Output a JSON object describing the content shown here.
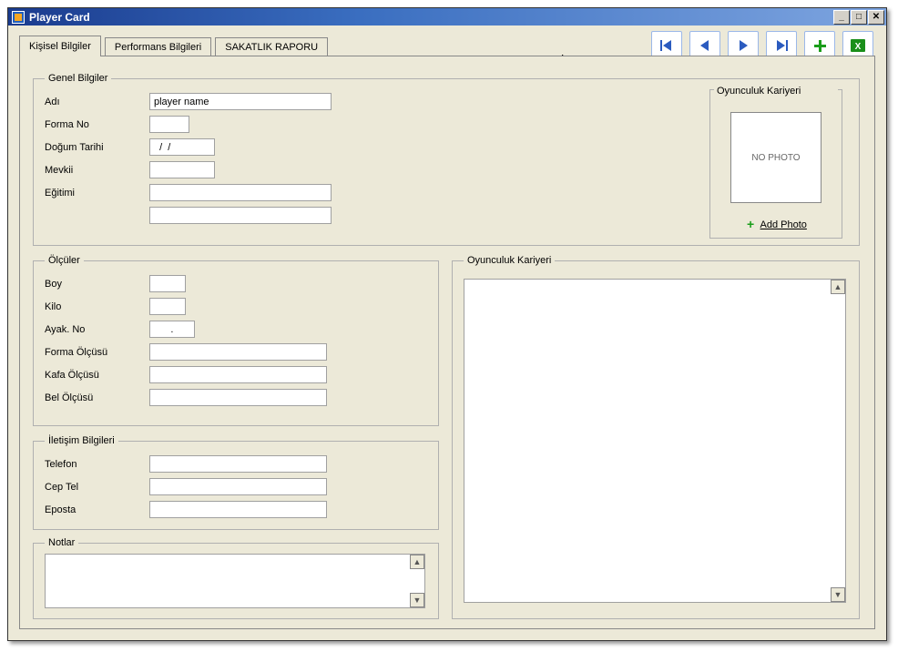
{
  "window": {
    "title": "Player Card"
  },
  "tabs": {
    "t1": "Kişisel Bilgiler",
    "t2": "Performans Bilgileri",
    "t3": "SAKATLIK RAPORU"
  },
  "groups": {
    "genel": "Genel Bilgiler",
    "olcu": "Ölçüler",
    "iletisim": "İletişim Bilgileri",
    "notlar": "Notlar",
    "kariyer": "Oyunculuk Kariyeri"
  },
  "labels": {
    "adi": "Adı",
    "forma_no": "Forma No",
    "dogum": "Doğum Tarihi",
    "mevkii": "Mevkii",
    "egitimi": "Eğitimi",
    "boy": "Boy",
    "kilo": "Kilo",
    "ayak": "Ayak. No",
    "forma_olcusu": "Forma Ölçüsü",
    "kafa_olcusu": "Kafa Ölçüsü",
    "bel_olcusu": "Bel Ölçüsü",
    "telefon": "Telefon",
    "cep": "Cep Tel",
    "eposta": "Eposta"
  },
  "values": {
    "adi": "player name",
    "forma_no": "",
    "dogum": "  /  /",
    "mevkii": "",
    "egitimi1": "",
    "egitimi2": "",
    "boy": "",
    "kilo": "",
    "ayak": "      .",
    "forma_olcusu": "",
    "kafa_olcusu": "",
    "bel_olcusu": "",
    "telefon": "",
    "cep": "",
    "eposta": "",
    "kariyer_text": "",
    "notlar_text": ""
  },
  "photo": {
    "legend": "Oyunculuk Kariyeri",
    "placeholder": "NO PHOTO",
    "add_label": "Add Photo"
  }
}
